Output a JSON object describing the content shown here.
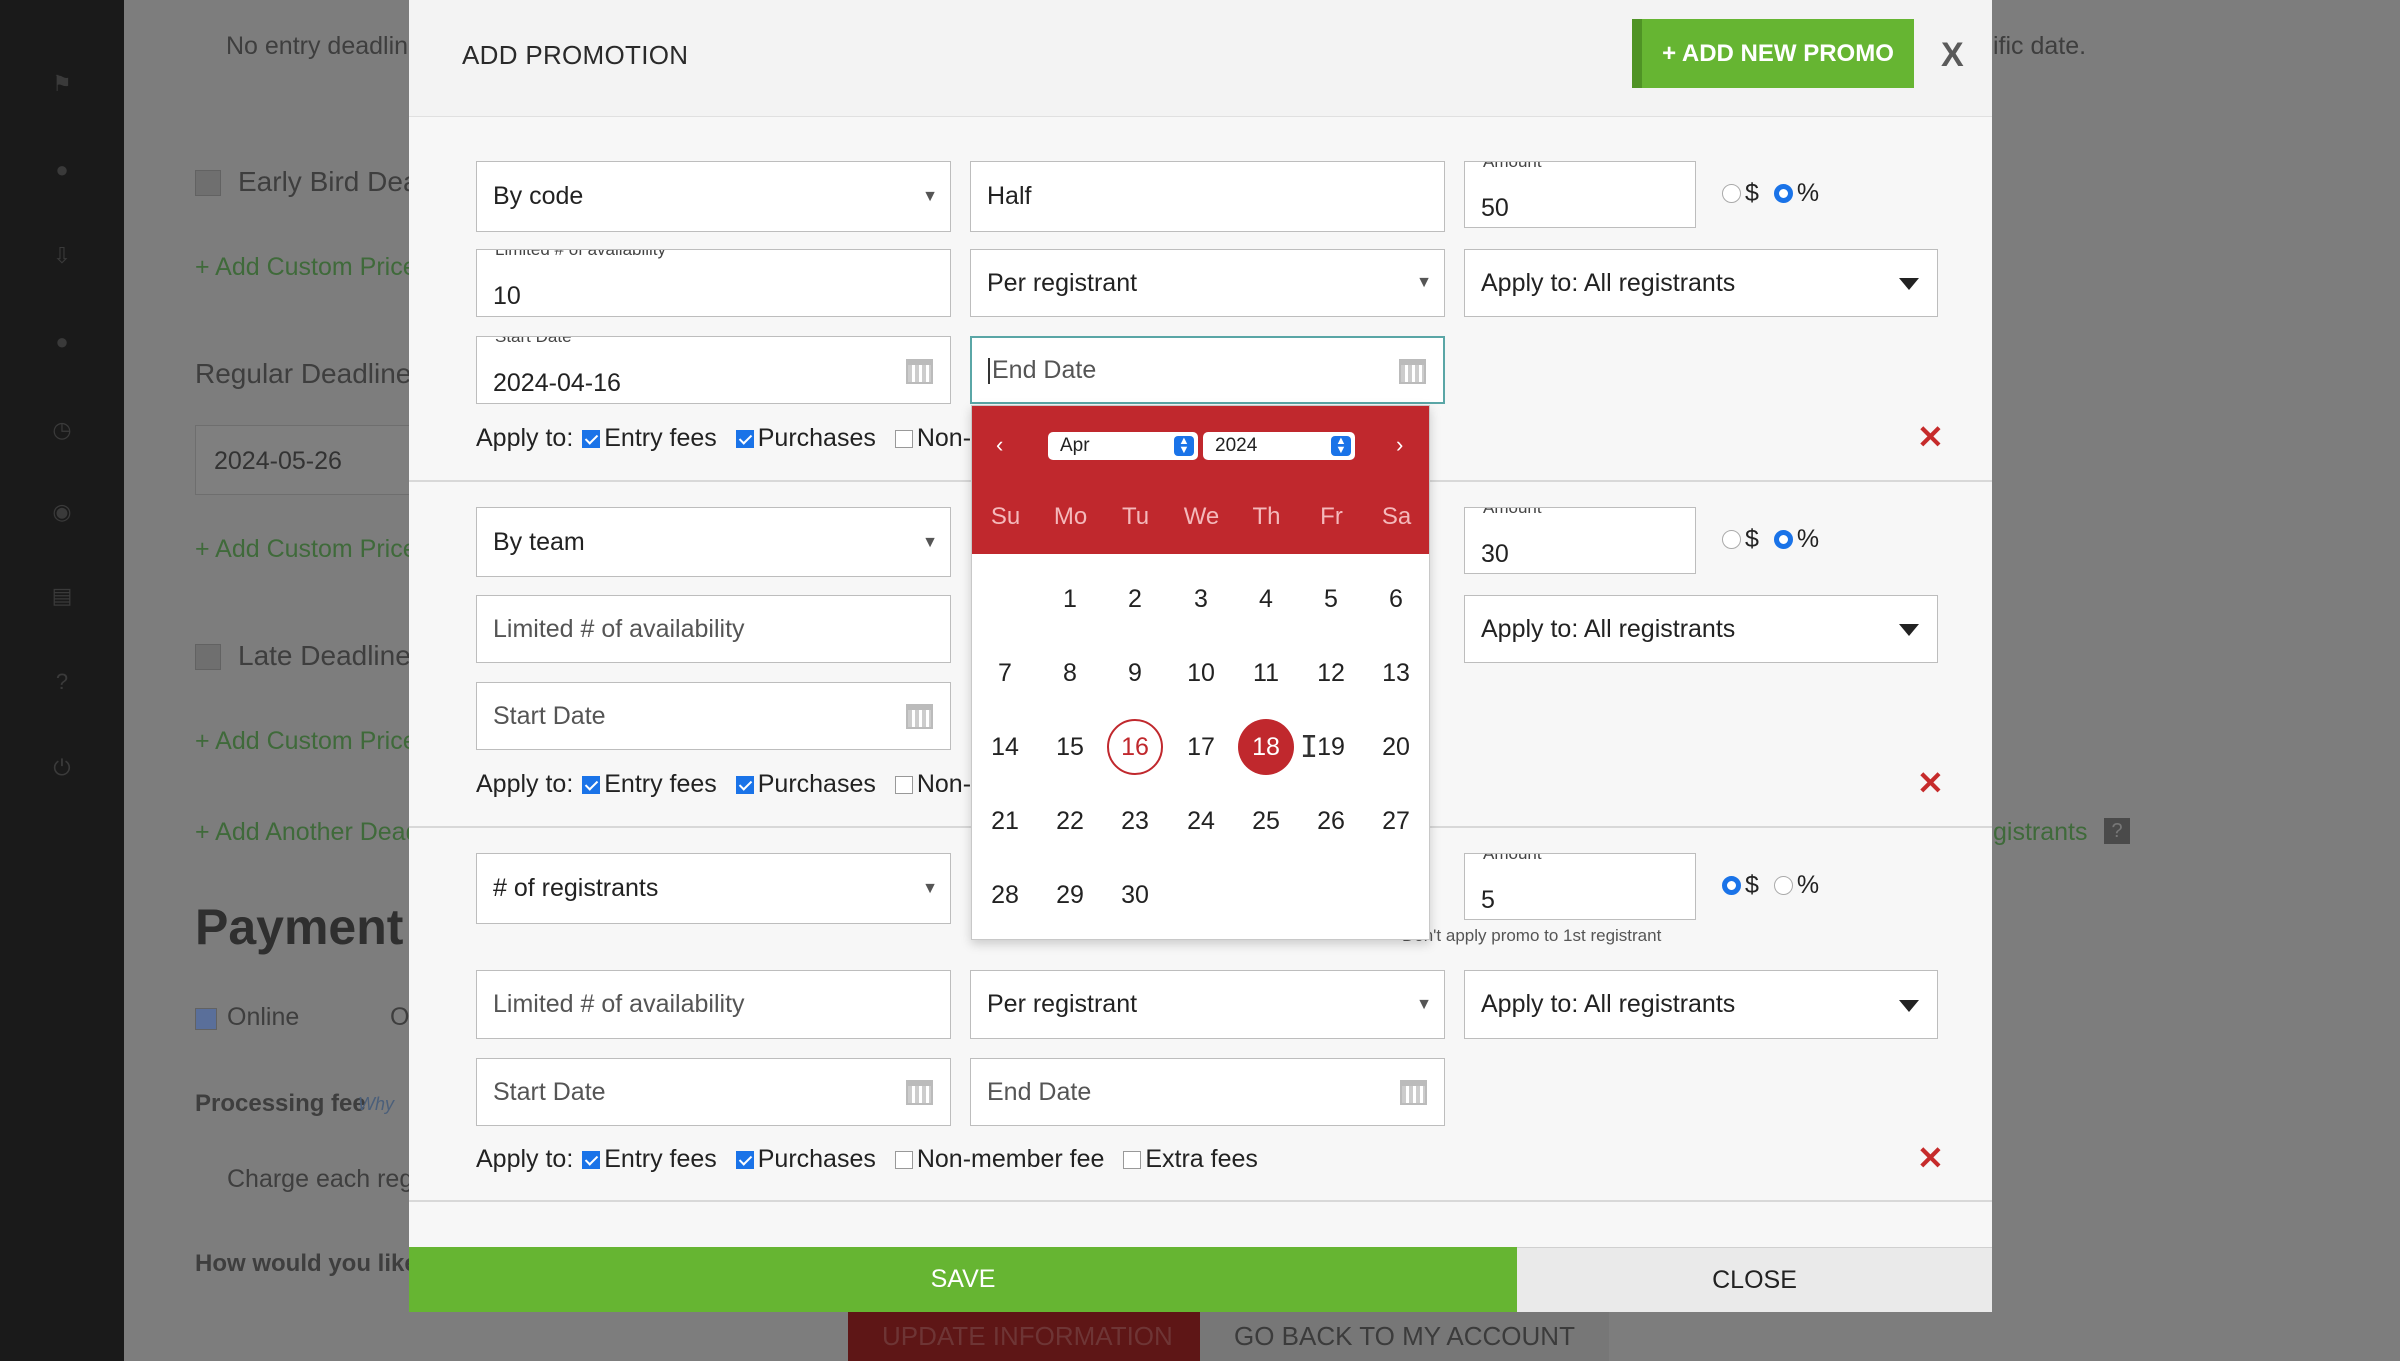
{
  "background": {
    "sidebar_icons": [
      "flag-icon",
      "users-icon",
      "download-icon",
      "chat-icon",
      "clock-icon",
      "user-icon",
      "card-icon",
      "help-icon",
      "power-icon"
    ],
    "no_entry_deadline": "No entry deadlin",
    "specific_date_tail": "ific date.",
    "early_bird": "Early Bird Dea",
    "add_custom_price_1": "+ Add Custom Price",
    "regular_deadline": "Regular Deadline",
    "regular_date": "2024-05-26",
    "add_custom_price_2": "+ Add Custom Price",
    "late_deadline": "Late Deadline",
    "add_custom_price_3": "+ Add Custom Price",
    "add_another_deadline": "+ Add Another Dead",
    "registrants_tail": "gistrants",
    "help_mark": "?",
    "payment_heading": "Payment",
    "online": "Online",
    "online_other": "O",
    "processing_fee": "Processing fee",
    "why": "Why",
    "charge_each": "Charge each regi",
    "how_would": "How would you like",
    "update_info": "UPDATE INFORMATION",
    "go_back": "GO BACK TO MY ACCOUNT"
  },
  "modal": {
    "title": "ADD PROMOTION",
    "add_new_promo": "+ ADD NEW PROMO",
    "close_x": "X",
    "save": "SAVE",
    "close": "CLOSE",
    "amount_label": "Amount",
    "limited_label": "Limited # of availability",
    "start_date_label": "Start Date",
    "dollar": "$",
    "percent": "%",
    "apply_to": "Apply to:",
    "entry_fees": "Entry fees",
    "purchases": "Purchases",
    "non_member_fee": "Non-member fee",
    "non_member_truncated": "Non-m",
    "extra_fees": "Extra fees",
    "delete_x": "✕",
    "promos": [
      {
        "type": "By code",
        "code": "Half",
        "amount": "50",
        "amount_unit": "%",
        "limited": "10",
        "per": "Per registrant",
        "apply_to": "Apply to: All registrants",
        "start_date": "2024-04-16",
        "end_date_placeholder": "End Date",
        "entry_fees_checked": true,
        "purchases_checked": true,
        "non_member_checked": false
      },
      {
        "type": "By team",
        "amount": "30",
        "amount_unit": "%",
        "limited_placeholder": "Limited # of availability",
        "apply_to": "Apply to: All registrants",
        "start_date_placeholder": "Start Date",
        "entry_fees_checked": true,
        "purchases_checked": true,
        "non_member_checked": false
      },
      {
        "type": "# of registrants",
        "amount": "5",
        "amount_unit": "$",
        "dont_apply_note": "Don't apply promo to 1st registrant",
        "limited_placeholder": "Limited # of availability",
        "per": "Per registrant",
        "apply_to": "Apply to: All registrants",
        "start_date_placeholder": "Start Date",
        "end_date_placeholder": "End Date",
        "entry_fees_checked": true,
        "purchases_checked": true,
        "non_member_checked": false,
        "extra_fees_checked": false
      }
    ]
  },
  "datepicker": {
    "prev": "‹",
    "next": "›",
    "month": "Apr",
    "year": "2024",
    "weekdays": [
      "Su",
      "Mo",
      "Tu",
      "We",
      "Th",
      "Fr",
      "Sa"
    ],
    "first_weekday_index": 1,
    "days_in_month": 30,
    "today": 16,
    "selected": 18,
    "accent": "#c0282d"
  },
  "colors": {
    "green": "#66b532",
    "red": "#c0282d",
    "blue": "#1a73e8"
  }
}
